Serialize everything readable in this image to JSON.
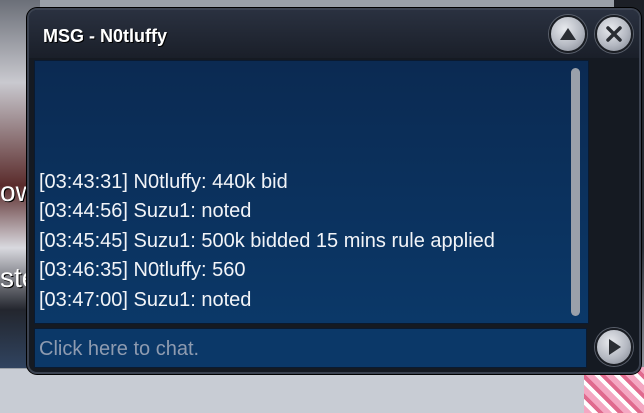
{
  "window": {
    "title": "MSG - N0tluffy"
  },
  "background": {
    "fragment_1": "ow",
    "fragment_2": "ste"
  },
  "chat": {
    "messages": [
      "[03:43:31] N0tluffy: 440k bid",
      "[03:44:56] Suzu1: noted",
      "[03:45:45] Suzu1: 500k bidded 15 mins rule applied",
      "[03:46:35] N0tluffy: 560",
      "[03:47:00] Suzu1: noted"
    ],
    "input_placeholder": "Click here to chat."
  },
  "icons": {
    "scroll_up": "chevron-up-icon",
    "close": "close-icon",
    "send": "play-arrow-icon"
  }
}
